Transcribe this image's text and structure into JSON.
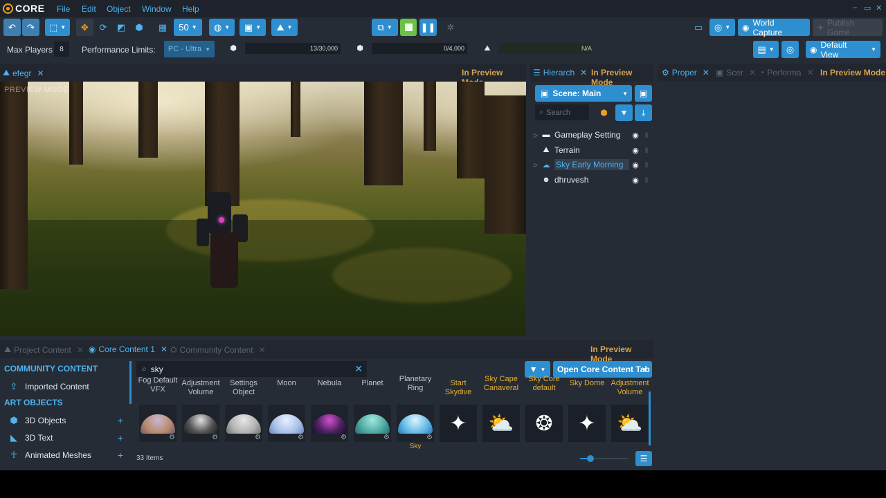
{
  "menubar": {
    "logo_text": "CORE",
    "items": [
      "File",
      "Edit",
      "Object",
      "Window",
      "Help"
    ],
    "window_controls": [
      "–",
      "▭",
      "✕"
    ]
  },
  "toolbar": {
    "grid_size": "50",
    "world_capture_label": "World Capture",
    "publish_label": "Publish Game"
  },
  "stats": {
    "max_players_label": "Max Players",
    "max_players_value": "8",
    "perf_limits_label": "Performance Limits:",
    "perf_platform": "PC - Ultra",
    "objects_count": "13/30,000",
    "networked_count": "0/4,000",
    "third_value": "N/A",
    "view_label": "Default View"
  },
  "viewport_panel": {
    "tab_label": "efegr",
    "mode": "In Preview Mode",
    "overlay_text": "PREVIEW MODE"
  },
  "hierarchy": {
    "tab_label": "Hierarch",
    "mode": "In Preview Mode",
    "scene_label": "Scene: Main",
    "search_placeholder": "Search",
    "rows": [
      {
        "label": "Gameplay Setting",
        "expandable": true,
        "icon": "folder-icon",
        "selected": false
      },
      {
        "label": "Terrain",
        "expandable": false,
        "icon": "terrain-icon",
        "selected": false
      },
      {
        "label": "Sky Early Morning",
        "expandable": true,
        "icon": "sky-icon",
        "selected": true
      },
      {
        "label": "dhruvesh",
        "expandable": false,
        "icon": "player-icon",
        "selected": false
      }
    ]
  },
  "properties": {
    "tabs": [
      "Proper",
      "Scer",
      "Performa"
    ],
    "mode": "In Preview Mode"
  },
  "content": {
    "tabs": [
      "Project Content",
      "Core Content 1",
      "Community Content"
    ],
    "mode": "In Preview Mode",
    "categories": {
      "community_header": "COMMUNITY CONTENT",
      "imported": "Imported Content",
      "art_header": "ART OBJECTS",
      "rows": [
        "3D Objects",
        "3D Text",
        "Animated Meshes"
      ]
    },
    "search_value": "sky",
    "open_core_label": "Open Core Content Tab",
    "items": [
      {
        "label": "Fog Default VFX",
        "color": "white"
      },
      {
        "label": "Adjustment Volume",
        "color": "white"
      },
      {
        "label": "Settings Object",
        "color": "white"
      },
      {
        "label": "Moon",
        "color": "white"
      },
      {
        "label": "Nebula",
        "color": "white"
      },
      {
        "label": "Planet",
        "color": "white"
      },
      {
        "label": "Planetary Ring",
        "color": "white"
      },
      {
        "label": "Start Skydive",
        "color": "gold"
      },
      {
        "label": "Sky Cape Canaveral",
        "color": "gold"
      },
      {
        "label": "Sky Core default",
        "color": "gold"
      },
      {
        "label": "Sky Dome",
        "color": "gold"
      },
      {
        "label": "Adjustment Volume",
        "color": "gold"
      }
    ],
    "below_label": "Sky",
    "count_label": "33 Items"
  },
  "colors": {
    "accent": "#2d8fd0",
    "preview_mode": "#d9a44a",
    "gold_label": "#e6b030"
  }
}
